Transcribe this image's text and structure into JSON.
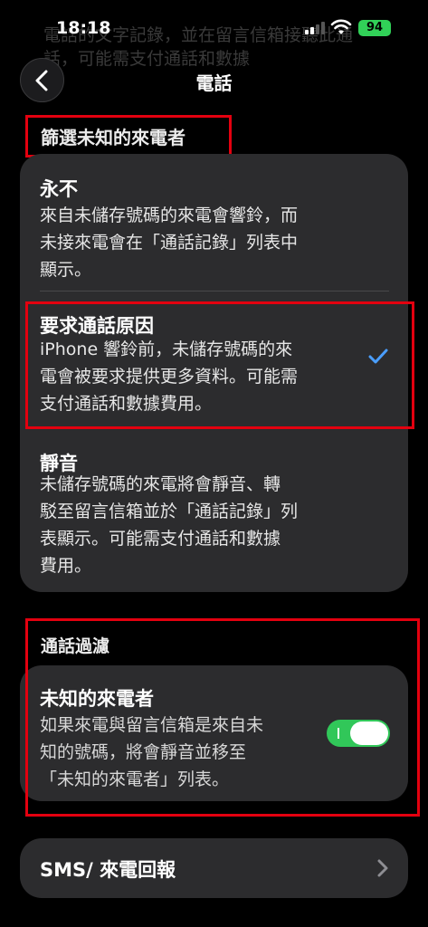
{
  "status_bar": {
    "time": "18:18",
    "battery": "94",
    "background_text": "電話的文字記錄，並在留言信箱接聽此通話，可能需支付通話和數據"
  },
  "nav": {
    "title": "電話",
    "back_icon": "chevron-left-icon"
  },
  "screen_unknown_callers": {
    "header": "篩選未知的來電者",
    "options": [
      {
        "title": "永不",
        "desc_lines": [
          "來自未儲存號碼的來電會響鈴，而",
          "未接來電會在「通話記錄」列表中",
          "顯示。"
        ],
        "selected": false
      },
      {
        "title": "要求通話原因",
        "desc_lines": [
          "iPhone 響鈴前，未儲存號碼的來",
          "電會被要求提供更多資料。可能需",
          "支付通話和數據費用。"
        ],
        "selected": true
      },
      {
        "title": "靜音",
        "desc_lines": [
          "未儲存號碼的來電將會靜音、轉",
          "駁至留言信箱並於「通話記錄」列",
          "表顯示。可能需支付通話和數據",
          "費用。"
        ],
        "selected": false
      }
    ]
  },
  "call_filtering": {
    "header": "通話過濾",
    "unknown_callers": {
      "title": "未知的來電者",
      "desc_lines": [
        "如果來電與留言信箱是來自未",
        "知的號碼，將會靜音並移至",
        "「未知的來電者」列表。"
      ],
      "toggle_on": true
    }
  },
  "sms_row": {
    "label": "SMS/ 來電回報",
    "icon": "chevron-right-icon"
  },
  "colors": {
    "background": "#000000",
    "card": "#2c2c2e",
    "accent_blue": "#4a9eff",
    "toggle_green": "#31c759",
    "highlight_red": "#e3000f"
  }
}
